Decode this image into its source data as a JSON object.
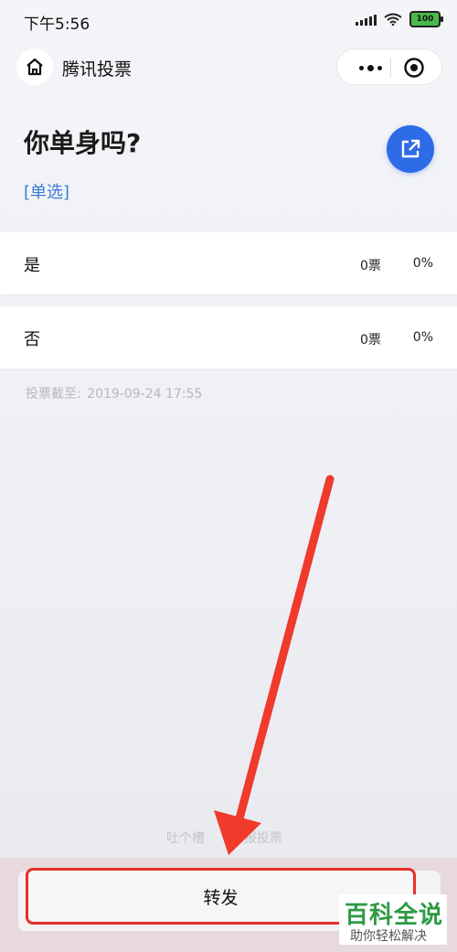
{
  "status_bar": {
    "time": "下午5:56",
    "battery": "100"
  },
  "nav": {
    "title": "腾讯投票"
  },
  "poll": {
    "question": "你单身吗?",
    "type_label": "[单选]",
    "options": [
      {
        "label": "是",
        "votes": "0票",
        "percent": "0%"
      },
      {
        "label": "否",
        "votes": "0票",
        "percent": "0%"
      }
    ],
    "deadline_label": "投票截至:",
    "deadline_value": "2019-09-24 17:55"
  },
  "footer": {
    "link1": "吐个槽",
    "link2": "举报投票"
  },
  "bottom": {
    "forward_label": "转发"
  },
  "watermark": {
    "title": "百科全说",
    "subtitle": "助你轻松解决"
  },
  "colors": {
    "accent": "#2e6be6",
    "highlight_red": "#e8302a",
    "watermark_green": "#2e9a44"
  }
}
